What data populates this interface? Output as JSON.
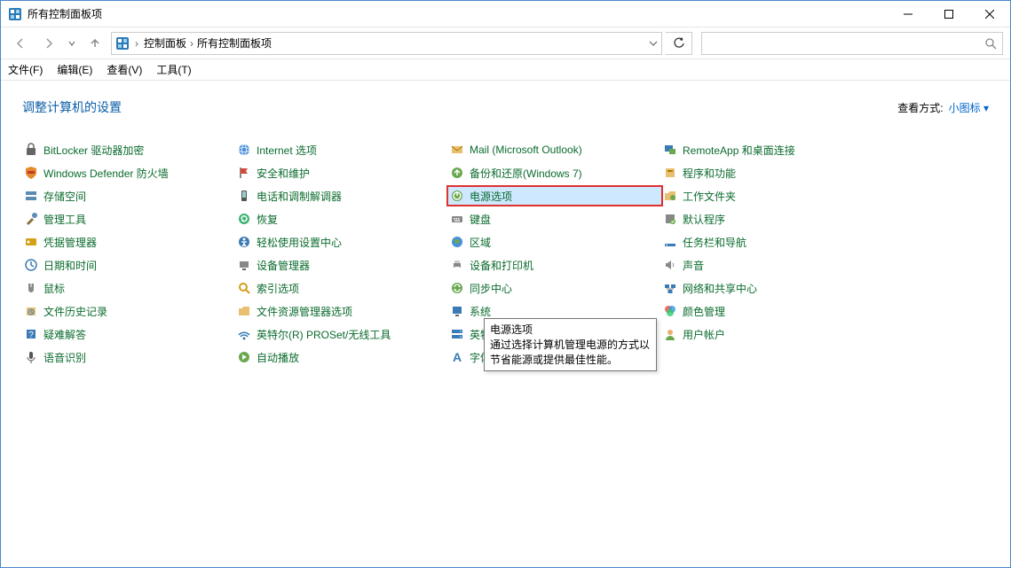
{
  "window": {
    "title": "所有控制面板项"
  },
  "breadcrumb": {
    "root": "控制面板",
    "current": "所有控制面板项"
  },
  "menus": {
    "file": "文件(F)",
    "edit": "编辑(E)",
    "view": "查看(V)",
    "tools": "工具(T)"
  },
  "header": {
    "page_title": "调整计算机的设置",
    "view_label": "查看方式:",
    "view_value": "小图标"
  },
  "tooltip": {
    "title": "电源选项",
    "body": "通过选择计算机管理电源的方式以节省能源或提供最佳性能。"
  },
  "columns": [
    [
      "BitLocker 驱动器加密",
      "Windows Defender 防火墙",
      "存储空间",
      "管理工具",
      "凭据管理器",
      "日期和时间",
      "鼠标",
      "文件历史记录",
      "疑难解答",
      "语音识别"
    ],
    [
      "Internet 选项",
      "安全和维护",
      "电话和调制解调器",
      "恢复",
      "轻松使用设置中心",
      "设备管理器",
      "索引选项",
      "文件资源管理器选项",
      "英特尔(R) PROSet/无线工具",
      "自动播放"
    ],
    [
      "Mail (Microsoft Outlook)",
      "备份和还原(Windows 7)",
      "电源选项",
      "键盘",
      "区域",
      "设备和打印机",
      "同步中心",
      "系统",
      "英特尔® 快速存储技术",
      "字体"
    ],
    [
      "RemoteApp 和桌面连接",
      "程序和功能",
      "工作文件夹",
      "默认程序",
      "任务栏和导航",
      "声音",
      "网络和共享中心",
      "颜色管理",
      "用户帐户"
    ]
  ],
  "icons": {
    "c0": [
      "bitlocker",
      "shield-firewall",
      "storage",
      "tools",
      "credential",
      "datetime",
      "mouse",
      "filehistory",
      "troubleshoot",
      "speech"
    ],
    "c1": [
      "globe",
      "flag",
      "phone",
      "recovery",
      "ease",
      "device-mgr",
      "search-idx",
      "folder-opts",
      "wifi",
      "autoplay"
    ],
    "c2": [
      "mail",
      "backup",
      "power",
      "keyboard",
      "region",
      "printer",
      "sync",
      "system",
      "raid",
      "font"
    ],
    "c3": [
      "remote",
      "programs",
      "workfolder",
      "defaults",
      "taskbar",
      "sound",
      "network",
      "color",
      "user"
    ]
  },
  "highlight": {
    "col": 2,
    "row": 2
  }
}
